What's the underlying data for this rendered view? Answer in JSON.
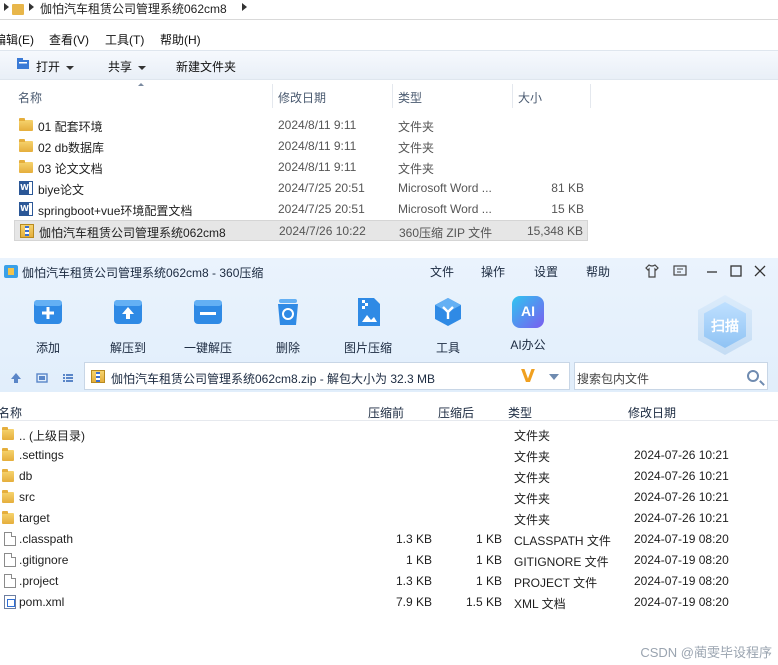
{
  "explorer": {
    "breadcrumb": "伽怕汽车租赁公司管理系统062cm8",
    "menu": [
      "编辑(E)",
      "查看(V)",
      "工具(T)",
      "帮助(H)"
    ],
    "toolbar": {
      "open": "打开",
      "share": "共享",
      "new_folder": "新建文件夹"
    },
    "columns": {
      "name": "名称",
      "date": "修改日期",
      "type": "类型",
      "size": "大小"
    },
    "files": [
      {
        "icon": "folder-icon",
        "name": "01 配套环境",
        "date": "2024/8/11 9:11",
        "type": "文件夹",
        "size": ""
      },
      {
        "icon": "folder-icon",
        "name": "02 db数据库",
        "date": "2024/8/11 9:11",
        "type": "文件夹",
        "size": ""
      },
      {
        "icon": "folder-icon",
        "name": "03 论文文档",
        "date": "2024/8/11 9:11",
        "type": "文件夹",
        "size": ""
      },
      {
        "icon": "word-doc-icon",
        "name": "biye论文",
        "date": "2024/7/25 20:51",
        "type": "Microsoft Word ...",
        "size": "81 KB"
      },
      {
        "icon": "word-doc-icon",
        "name": "springboot+vue环境配置文档",
        "date": "2024/7/25 20:51",
        "type": "Microsoft Word ...",
        "size": "15 KB"
      },
      {
        "icon": "zip-archive-icon",
        "name": "伽怕汽车租赁公司管理系统062cm8",
        "date": "2024/7/26 10:22",
        "type": "360压缩 ZIP 文件",
        "size": "15,348 KB",
        "selected": true
      }
    ]
  },
  "zip": {
    "title": "伽怕汽车租赁公司管理系统062cm8 - 360压缩",
    "menu": [
      "文件",
      "操作",
      "设置",
      "帮助"
    ],
    "tools": [
      {
        "label": "添加",
        "icon": "add-icon"
      },
      {
        "label": "解压到",
        "icon": "extract-to-icon"
      },
      {
        "label": "一键解压",
        "icon": "one-click-extract-icon"
      },
      {
        "label": "删除",
        "icon": "delete-icon"
      },
      {
        "label": "图片压缩",
        "icon": "image-compress-icon"
      },
      {
        "label": "工具",
        "icon": "tools-icon"
      },
      {
        "label": "AI办公",
        "icon": "ai-office-icon"
      }
    ],
    "scan_label": "扫描",
    "ai_badge": "AI",
    "path": "伽怕汽车租赁公司管理系统062cm8.zip - 解包大小为 32.3 MB",
    "v_badge": "V",
    "search_placeholder": "搜索包内文件",
    "columns": {
      "name": "名称",
      "compressed_before": "压缩前",
      "compressed_after": "压缩后",
      "type": "类型",
      "date": "修改日期"
    },
    "rows": [
      {
        "icon": "folder-icon",
        "name": ".. (上级目录)",
        "before": "",
        "after": "",
        "type": "文件夹",
        "date": ""
      },
      {
        "icon": "folder-icon",
        "name": ".settings",
        "before": "",
        "after": "",
        "type": "文件夹",
        "date": "2024-07-26 10:21"
      },
      {
        "icon": "folder-icon",
        "name": "db",
        "before": "",
        "after": "",
        "type": "文件夹",
        "date": "2024-07-26 10:21"
      },
      {
        "icon": "folder-icon",
        "name": "src",
        "before": "",
        "after": "",
        "type": "文件夹",
        "date": "2024-07-26 10:21"
      },
      {
        "icon": "folder-icon",
        "name": "target",
        "before": "",
        "after": "",
        "type": "文件夹",
        "date": "2024-07-26 10:21"
      },
      {
        "icon": "file-icon",
        "name": ".classpath",
        "before": "1.3 KB",
        "after": "1 KB",
        "type": "CLASSPATH 文件",
        "date": "2024-07-19 08:20"
      },
      {
        "icon": "file-icon",
        "name": ".gitignore",
        "before": "1 KB",
        "after": "1 KB",
        "type": "GITIGNORE 文件",
        "date": "2024-07-19 08:20"
      },
      {
        "icon": "file-icon",
        "name": ".project",
        "before": "1.3 KB",
        "after": "1 KB",
        "type": "PROJECT 文件",
        "date": "2024-07-19 08:20"
      },
      {
        "icon": "xml-file-icon",
        "name": "pom.xml",
        "before": "7.9 KB",
        "after": "1.5 KB",
        "type": "XML 文档",
        "date": "2024-07-19 08:20"
      }
    ]
  },
  "watermark": "CSDN @蔺雯毕设程序",
  "colors": {
    "toolbar_blue": "#2f8ae5",
    "accent_purple": "#7b5cf0",
    "folder_yellow": "#e5ae3c",
    "v_orange": "#f0a020"
  }
}
